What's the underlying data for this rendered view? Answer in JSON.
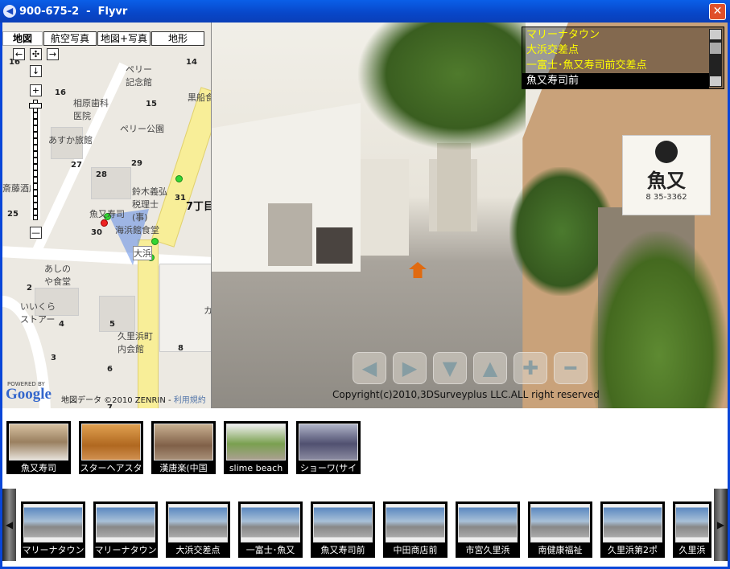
{
  "window": {
    "title": "900-675-2  -  Flyvr",
    "close": "✕"
  },
  "map": {
    "tabs": [
      "地図",
      "航空写真",
      "地図+写真",
      "地形"
    ],
    "controls": {
      "left": "←",
      "center": "✣",
      "right": "→",
      "down": "↓",
      "zoom_in": "+",
      "zoom_out": "—"
    },
    "labels": [
      "ペリー記念館",
      "相原歯科医院",
      "ペリー公園",
      "あすか旅館",
      "鈴木義弘税理士(事)",
      "斎藤酒店",
      "魚又寿司",
      "海浜館食堂",
      "大浜",
      "あしのや食堂",
      "いいくらストアー",
      "久里浜町内会館",
      "黒船食",
      "7丁目",
      "カ"
    ],
    "numbers": [
      "14",
      "16",
      "15",
      "27",
      "28",
      "29",
      "31",
      "25",
      "30",
      "2",
      "4",
      "5",
      "3",
      "6",
      "8",
      "7",
      "16"
    ],
    "powered_by": "POWERED BY",
    "google": "Google",
    "attribution": "地図データ ©2010 ZENRIN - ",
    "terms_link": "利用規約"
  },
  "panorama": {
    "poi_list": [
      "マリーナタウン",
      "大浜交差点",
      "一富士･魚又寿司前交差点",
      "魚又寿司前"
    ],
    "selected_index": 3,
    "nav_buttons": [
      "◀",
      "▶",
      "▼",
      "▲",
      "✚",
      "━"
    ],
    "copyright": "Copyright(c)2010,3DSurveyplus LLC.ALL right reserved",
    "sign_text": "魚又",
    "sign_phone": "8 35-3362"
  },
  "featured": [
    "魚又寿司",
    "スターヘアスタ",
    "漢唐楽(中国",
    "slime beach",
    "ショーワ(サイ"
  ],
  "strip": [
    "マリーナタウン",
    "マリーナタウン",
    "大浜交差点",
    "一富士･魚又",
    "魚又寿司前",
    "中田商店前",
    "市宮久里浜",
    "南健康福祉",
    "久里浜第2ポ",
    "久里浜"
  ],
  "colors": {
    "titlebar": "#0846c8",
    "poi_text": "#ffff00",
    "road": "#f8ee98"
  }
}
